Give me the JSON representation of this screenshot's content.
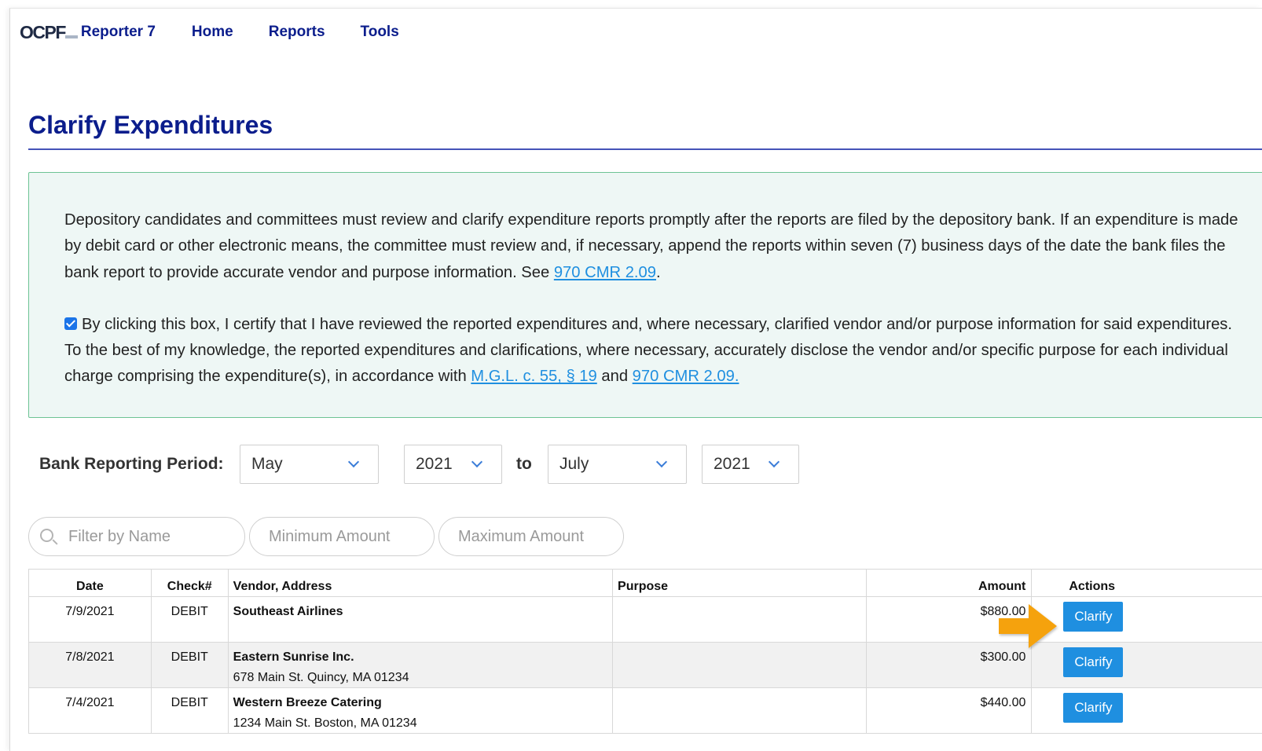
{
  "nav": {
    "logo_mark": "OCPF",
    "app_name": "Reporter 7",
    "links": [
      "Home",
      "Reports",
      "Tools"
    ]
  },
  "page": {
    "title": "Clarify Expenditures"
  },
  "notice": {
    "para1_text": "Depository candidates and committees must review and clarify expenditure reports promptly after the reports are filed by the depository bank. If an expenditure is made by debit card or other electronic means, the committee must review and, if necessary, append the reports within seven (7) business days of the date the bank files the bank report to provide accurate vendor and purpose information. See ",
    "para1_link": "970 CMR 2.09",
    "para1_end": ".",
    "certify_checked": true,
    "para2_text": "By clicking this box, I certify that I have reviewed the reported expenditures and, where necessary, clarified vendor and/or purpose information for said expenditures. To the best of my knowledge, the reported expenditures and clarifications, where necessary, accurately disclose the vendor and/or specific purpose for each individual charge comprising the expenditure(s), in accordance with ",
    "para2_link1": "M.G.L. c. 55, § 19",
    "para2_mid": " and ",
    "para2_link2": "970 CMR 2.09."
  },
  "period": {
    "label": "Bank Reporting Period:",
    "from_month": "May",
    "from_year": "2021",
    "to_label": "to",
    "to_month": "July",
    "to_year": "2021"
  },
  "filters": {
    "name_placeholder": "Filter by Name",
    "min_placeholder": "Minimum Amount",
    "max_placeholder": "Maximum Amount"
  },
  "table": {
    "headers": {
      "date": "Date",
      "check": "Check#",
      "vendor": "Vendor, Address",
      "purpose": "Purpose",
      "amount": "Amount",
      "actions": "Actions"
    },
    "rows": [
      {
        "date": "7/9/2021",
        "check": "DEBIT",
        "vendor": "Southeast Airlines",
        "address": "",
        "purpose": "",
        "amount": "$880.00",
        "action": "Clarify"
      },
      {
        "date": "7/8/2021",
        "check": "DEBIT",
        "vendor": "Eastern Sunrise Inc.",
        "address": "678 Main St. Quincy, MA 01234",
        "purpose": "",
        "amount": "$300.00",
        "action": "Clarify"
      },
      {
        "date": "7/4/2021",
        "check": "DEBIT",
        "vendor": "Western Breeze Catering",
        "address": "1234 Main St. Boston, MA 01234",
        "purpose": "",
        "amount": "$440.00",
        "action": "Clarify"
      }
    ]
  },
  "colors": {
    "brand_navy": "#0b1d8c",
    "link_blue": "#1f8fe0",
    "notice_border": "#6dc394",
    "notice_bg": "#eef7f5",
    "arrow": "#f5a20c"
  }
}
